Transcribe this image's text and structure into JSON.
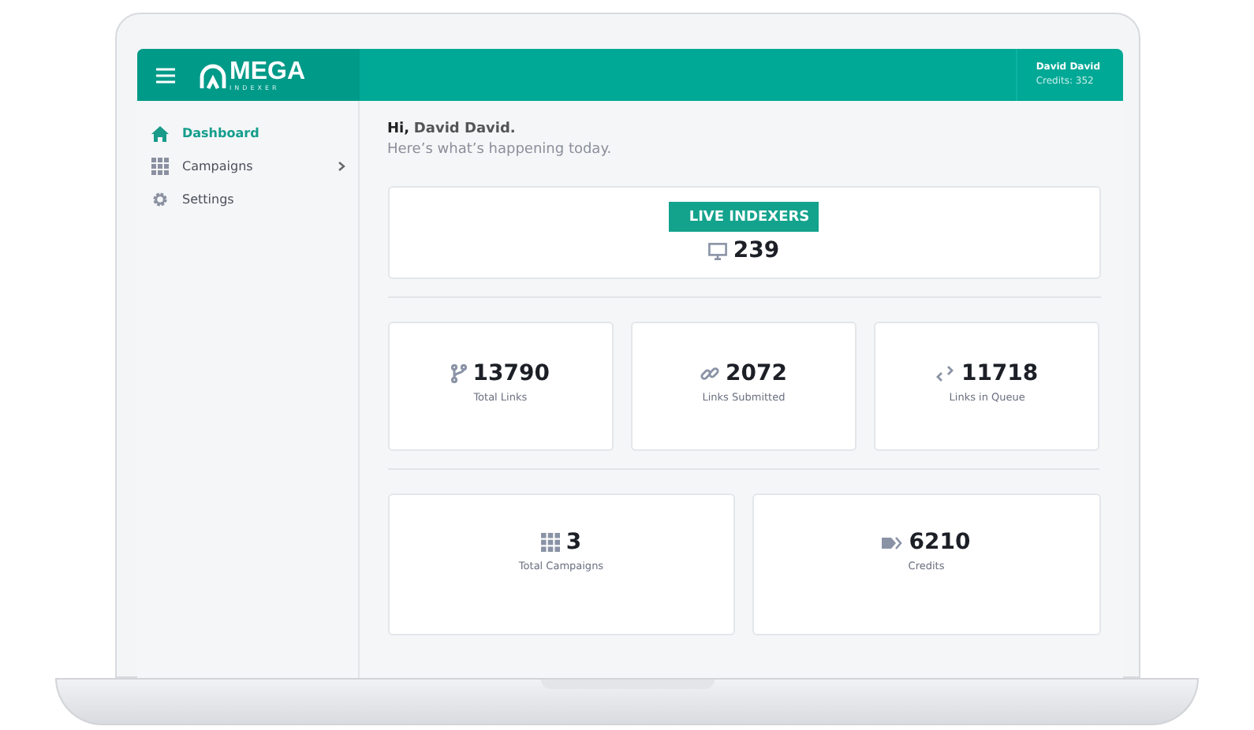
{
  "header": {
    "logo": "MEGA",
    "logo_sub": "INDEXER",
    "user_name": "David David",
    "user_credits": "Credits: 352"
  },
  "sidebar": {
    "items": [
      {
        "label": "Dashboard",
        "kind": "home",
        "selected": true,
        "expandable": false
      },
      {
        "label": "Campaigns",
        "kind": "grid",
        "selected": false,
        "expandable": true
      },
      {
        "label": "Settings",
        "kind": "gear",
        "selected": false,
        "expandable": false
      }
    ]
  },
  "greeting": {
    "prefix": "Hi,",
    "name": "David David.",
    "subtitle": "Here’s what’s happening today."
  },
  "live": {
    "badge": "LIVE INDEXERS",
    "value": "239"
  },
  "stats_row_1": [
    {
      "kind": "branch",
      "value": "13790",
      "label": "Total Links"
    },
    {
      "kind": "link",
      "value": "2072",
      "label": "Links Submitted"
    },
    {
      "kind": "broken",
      "value": "11718",
      "label": "Links in Queue"
    }
  ],
  "stats_row_2": [
    {
      "kind": "grid",
      "value": "3",
      "label": "Total Campaigns"
    },
    {
      "kind": "tags",
      "value": "6210",
      "label": "Credits"
    }
  ]
}
